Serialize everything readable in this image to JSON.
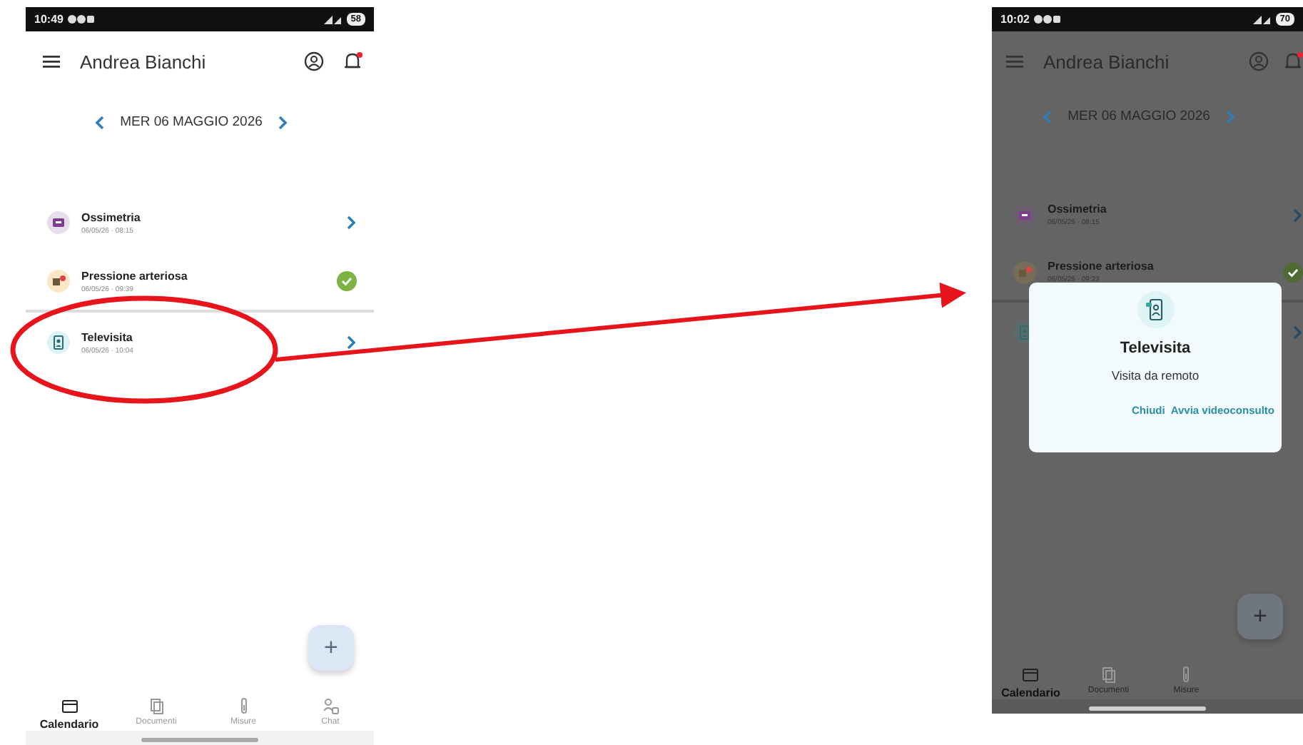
{
  "screens": [
    {
      "dimmed": false,
      "status_bar": {
        "time": "10:49",
        "battery": "58"
      },
      "header": {
        "title": "Andrea Bianchi",
        "notification": true
      },
      "date_nav": {
        "label": "MER 06 MAGGIO 2026"
      },
      "events": [
        {
          "kind": "oximetry",
          "color": "#e9dcef",
          "title": "Ossimetria",
          "subtitle": "06/05/26 · 08:15",
          "completed": false
        },
        {
          "kind": "pressure",
          "color": "#fbe7c6",
          "title": "Pressione arteriosa",
          "subtitle": "06/05/26 · 09:39",
          "completed": true
        },
        {
          "kind": "televisit",
          "color": "#ddf2f4",
          "title": "Televisita",
          "subtitle": "06/05/26 · 10:04",
          "completed": false
        }
      ],
      "fab": {
        "label": "+"
      },
      "bottom_nav": [
        {
          "kind": "calendar",
          "label": "Calendario",
          "selected": true
        },
        {
          "kind": "documents",
          "label": "Documenti",
          "selected": false
        },
        {
          "kind": "measures",
          "label": "Misure",
          "selected": false
        },
        {
          "kind": "chat",
          "label": "Chat",
          "selected": false
        }
      ]
    },
    {
      "dimmed": true,
      "status_bar": {
        "time": "10:02",
        "battery": "70"
      },
      "header": {
        "title": "Andrea Bianchi",
        "notification": true
      },
      "date_nav": {
        "label": "MER 06 MAGGIO 2026"
      },
      "events": [
        {
          "kind": "oximetry",
          "color": "#6a5e6e",
          "title": "Ossimetria",
          "subtitle": "06/05/26 · 08:15",
          "completed": false
        },
        {
          "kind": "pressure",
          "color": "#776c58",
          "title": "Pressione arteriosa",
          "subtitle": "06/05/26 · 09:23",
          "completed": true
        },
        {
          "kind": "televisit",
          "color": "#5d6a6b",
          "completed": false
        }
      ],
      "fab": {
        "label": "+"
      },
      "bottom_nav": [
        {
          "kind": "calendar",
          "label": "Calendario",
          "selected": true
        },
        {
          "kind": "documents",
          "label": "Documenti",
          "selected": false
        },
        {
          "kind": "measures",
          "label": "Misure",
          "selected": false
        }
      ],
      "dialog": {
        "title": "Televisita",
        "message": "Visita da remoto",
        "actions": [
          "Chiudi",
          "Avvia videoconsulto"
        ]
      }
    }
  ]
}
